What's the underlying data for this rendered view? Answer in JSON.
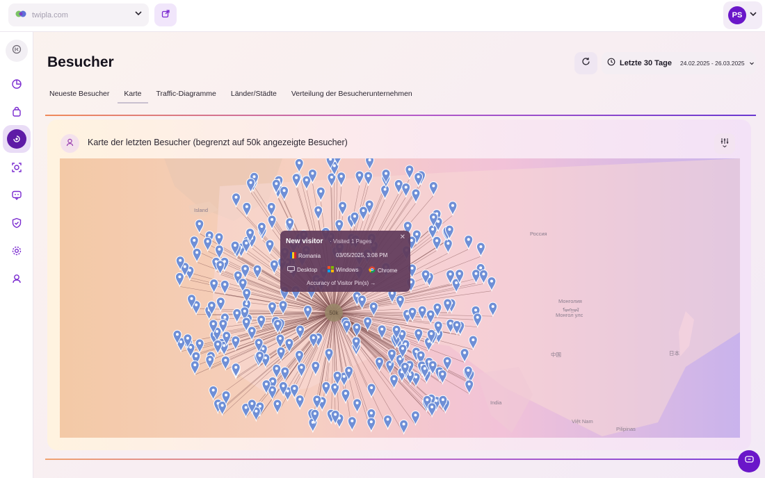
{
  "topbar": {
    "site": "twipla.com",
    "user_initials": "PS"
  },
  "page": {
    "title": "Besucher"
  },
  "date_range": {
    "label": "Letzte 30 Tage",
    "dates": "24.02.2025 - 26.03.2025"
  },
  "tabs": [
    {
      "label": "Neueste Besucher",
      "active": false
    },
    {
      "label": "Karte",
      "active": true
    },
    {
      "label": "Traffic-Diagramme",
      "active": false
    },
    {
      "label": "Länder/Städte",
      "active": false
    },
    {
      "label": "Verteilung der Besucherunternehmen",
      "active": false
    }
  ],
  "map_card": {
    "title": "Karte der letzten Besucher (begrenzt auf 50k angezeigte Besucher)",
    "cluster_label": "50k",
    "map_labels": [
      {
        "text": "Island"
      },
      {
        "text": "Россия"
      },
      {
        "text": "Монголия"
      },
      {
        "text": "ᠮᠣᠩᠭᠣᠯ"
      },
      {
        "text": "Монгол улс"
      },
      {
        "text": "中国"
      },
      {
        "text": "日本"
      },
      {
        "text": "India"
      },
      {
        "text": "Việt Nam"
      },
      {
        "text": "Pilipinas"
      }
    ]
  },
  "tooltip": {
    "title": "New visitor",
    "subtitle": "· Visited 1 Pages",
    "country": "Romania",
    "datetime": "03/05/2025, 3:08 PM",
    "device": "Desktop",
    "os": "Windows",
    "browser": "Chrome",
    "link": "Accuracy of Visitor Pin(s) →"
  },
  "colors": {
    "accent": "#6a16c9",
    "pin": "#6f8fd6"
  },
  "icons": {
    "collapse": "sidebar-collapse-icon",
    "nav": [
      "dashboard-icon",
      "shopping-bag-icon",
      "visitors-icon",
      "target-icon",
      "feedback-icon",
      "shield-icon",
      "settings-icon",
      "location-icon"
    ]
  }
}
